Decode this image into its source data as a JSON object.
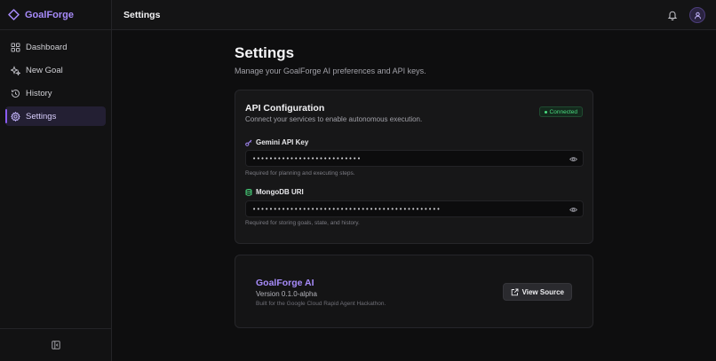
{
  "brand": {
    "name": "GoalForge"
  },
  "sidebar": {
    "items": [
      {
        "label": "Dashboard",
        "icon": "dashboard-icon",
        "active": false
      },
      {
        "label": "New Goal",
        "icon": "sparkles-icon",
        "active": false
      },
      {
        "label": "History",
        "icon": "history-icon",
        "active": false
      },
      {
        "label": "Settings",
        "icon": "gear-icon",
        "active": true
      }
    ],
    "footer_icon": "collapse-sidebar-icon"
  },
  "header": {
    "title": "Settings",
    "bell_icon": "bell-icon",
    "avatar_icon": "user-icon"
  },
  "page": {
    "title": "Settings",
    "subtitle": "Manage your GoalForge AI preferences and API keys."
  },
  "api_card": {
    "title": "API Configuration",
    "subtitle": "Connect your services to enable autonomous execution.",
    "status": "Connected",
    "fields": [
      {
        "label": "Gemini API Key",
        "icon": "key-icon",
        "value": "••••••••••••••••••••••••••",
        "help": "Required for planning and executing steps."
      },
      {
        "label": "MongoDB URI",
        "icon": "database-icon",
        "value": "•••••••••••••••••••••••••••••••••••••••••••••",
        "help": "Required for storing goals, state, and history."
      }
    ]
  },
  "about": {
    "title": "GoalForge AI",
    "version": "Version 0.1.0-alpha",
    "note": "Built for the Google Cloud Rapid Agent Hackathon.",
    "button_label": "View Source"
  },
  "colors": {
    "accent": "#a78bfa",
    "accent_strong": "#8b5cf6",
    "success": "#4ade80",
    "background": "#0e0e0f"
  }
}
